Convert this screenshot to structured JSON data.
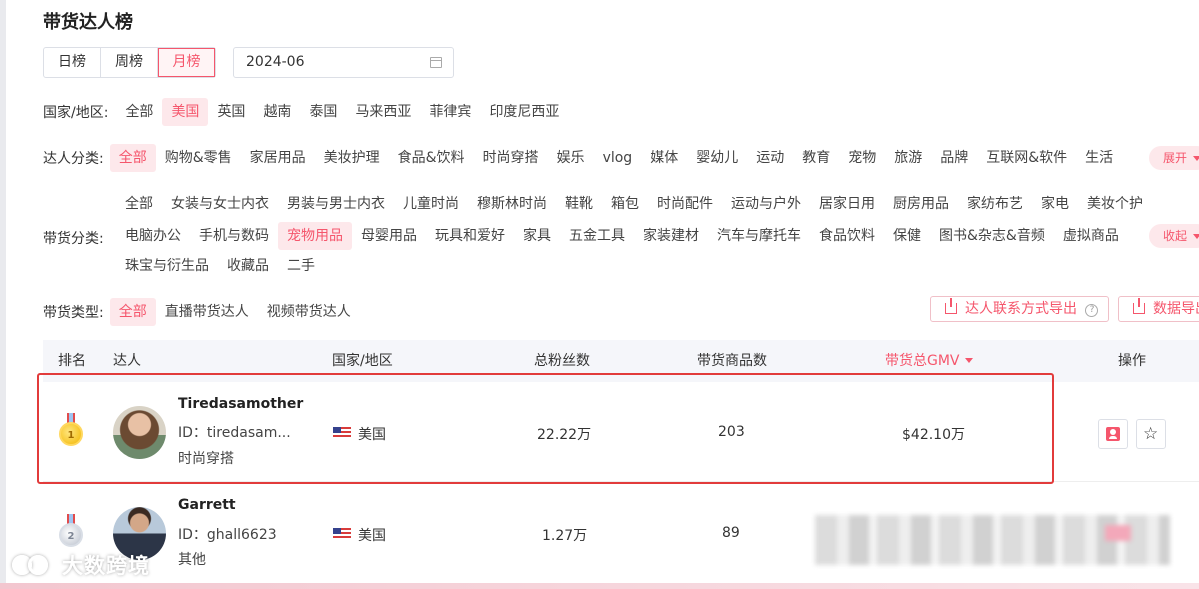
{
  "page": {
    "title": "带货达人榜"
  },
  "period_tabs": [
    {
      "label": "日榜",
      "active": false
    },
    {
      "label": "周榜",
      "active": false
    },
    {
      "label": "月榜",
      "active": true
    }
  ],
  "date_picker": {
    "value": "2024-06",
    "icon": "calendar-icon"
  },
  "filters": {
    "country": {
      "label": "国家/地区:",
      "options": [
        "全部",
        "美国",
        "英国",
        "越南",
        "泰国",
        "马来西亚",
        "菲律宾",
        "印度尼西亚"
      ],
      "active": "美国"
    },
    "influencer_category": {
      "label": "达人分类:",
      "options": [
        "全部",
        "购物&零售",
        "家居用品",
        "美妆护理",
        "食品&饮料",
        "时尚穿搭",
        "娱乐",
        "vlog",
        "媒体",
        "婴幼儿",
        "运动",
        "教育",
        "宠物",
        "旅游",
        "品牌",
        "互联网&软件",
        "生活"
      ],
      "active": "全部",
      "toggle_label": "展开"
    },
    "goods_category": {
      "label": "带货分类:",
      "rows": [
        [
          "全部",
          "女装与女士内衣",
          "男装与男士内衣",
          "儿童时尚",
          "穆斯林时尚",
          "鞋靴",
          "箱包",
          "时尚配件",
          "运动与户外",
          "居家日用",
          "厨房用品",
          "家纺布艺",
          "家电",
          "美妆个护"
        ],
        [
          "电脑办公",
          "手机与数码",
          "宠物用品",
          "母婴用品",
          "玩具和爱好",
          "家具",
          "五金工具",
          "家装建材",
          "汽车与摩托车",
          "食品饮料",
          "保健",
          "图书&杂志&音频",
          "虚拟商品"
        ],
        [
          "珠宝与衍生品",
          "收藏品",
          "二手"
        ]
      ],
      "active": "宠物用品",
      "toggle_label": "收起"
    },
    "sales_type": {
      "label": "带货类型:",
      "options": [
        "全部",
        "直播带货达人",
        "视频带货达人"
      ],
      "active": "全部"
    }
  },
  "export_buttons": {
    "contact_export": "达人联系方式导出",
    "data_export": "数据导出",
    "help_icon_text": "?"
  },
  "table": {
    "headers": {
      "rank": "排名",
      "influencer": "达人",
      "country": "国家/地区",
      "followers": "总粉丝数",
      "products": "带货商品数",
      "gmv": "带货总GMV",
      "actions": "操作"
    },
    "sorted_by": "gmv",
    "rows": [
      {
        "rank": "1",
        "medal": "gold",
        "name": "Tiredasamother",
        "id": "ID：tiredasam...",
        "category": "时尚穿搭",
        "country": "美国",
        "followers": "22.22万",
        "products": "203",
        "gmv": "$42.10万",
        "highlighted": true
      },
      {
        "rank": "2",
        "medal": "silver",
        "name": "Garrett",
        "id": "ID：ghall6623",
        "category": "其他",
        "country": "美国",
        "followers": "1.27万",
        "products": "89",
        "gmv": "",
        "highlighted": false
      }
    ]
  },
  "watermark": {
    "text": "大数跨境"
  },
  "colors": {
    "accent": "#f5566c",
    "accent_bg": "#fde8eb",
    "highlight_border": "#e23b3b",
    "header_bg": "#f5f6fa"
  }
}
